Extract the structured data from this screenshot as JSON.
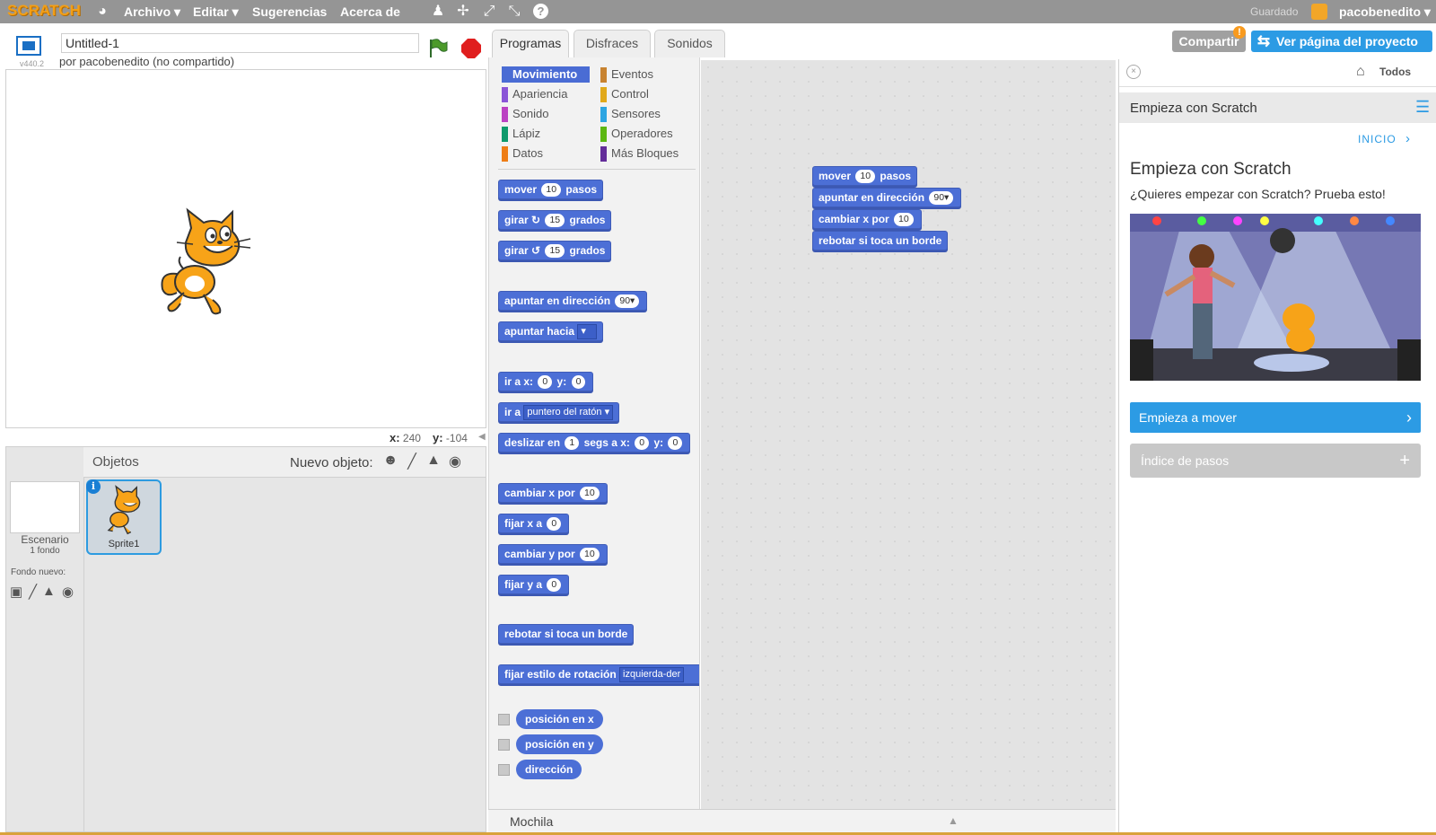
{
  "menubar": {
    "logo": "SCRATCH",
    "items": [
      "Archivo",
      "Editar",
      "Sugerencias",
      "Acerca de"
    ],
    "saved_status": "Guardado",
    "username": "pacobenedito"
  },
  "stage": {
    "project_title": "Untitled-1",
    "byline": "por pacobenedito (no compartido)",
    "version": "v440.2",
    "coords": {
      "x_label": "x:",
      "x_value": "240",
      "y_label": "y:",
      "y_value": "-104"
    }
  },
  "sprites": {
    "header": "Objetos",
    "new_sprite_label": "Nuevo objeto:",
    "stage_label": "Escenario",
    "stage_backdrops": "1 fondo",
    "new_backdrop_label": "Fondo nuevo:",
    "sprite_name": "Sprite1"
  },
  "tabs": [
    "Programas",
    "Disfraces",
    "Sonidos"
  ],
  "categories": [
    {
      "label": "Movimiento",
      "color": "#4a6cd4"
    },
    {
      "label": "Apariencia",
      "color": "#8a55d7"
    },
    {
      "label": "Sonido",
      "color": "#bb42c3"
    },
    {
      "label": "Lápiz",
      "color": "#0e9a6c"
    },
    {
      "label": "Datos",
      "color": "#ee7d16"
    },
    {
      "label": "Eventos",
      "color": "#c88330"
    },
    {
      "label": "Control",
      "color": "#e1a91a"
    },
    {
      "label": "Sensores",
      "color": "#2ca5e2"
    },
    {
      "label": "Operadores",
      "color": "#5cb712"
    },
    {
      "label": "Más Bloques",
      "color": "#632d99"
    }
  ],
  "palette_blocks": {
    "mover": {
      "pre": "mover",
      "val": "10",
      "post": "pasos"
    },
    "girar_der": {
      "pre": "girar",
      "val": "15",
      "post": "grados"
    },
    "girar_izq": {
      "pre": "girar",
      "val": "15",
      "post": "grados"
    },
    "apuntar_dir": {
      "pre": "apuntar en dirección",
      "val": "90▾"
    },
    "apuntar_hacia": {
      "pre": "apuntar hacia",
      "val": "▾"
    },
    "ir_xy": {
      "pre": "ir a x:",
      "x": "0",
      "mid": "y:",
      "y": "0"
    },
    "ir_a": {
      "pre": "ir a",
      "val": "puntero del ratón ▾"
    },
    "deslizar": {
      "pre": "deslizar en",
      "t": "1",
      "mid1": "segs a x:",
      "x": "0",
      "mid2": "y:",
      "y": "0"
    },
    "cambiar_x": {
      "pre": "cambiar x por",
      "val": "10"
    },
    "fijar_x": {
      "pre": "fijar x a",
      "val": "0"
    },
    "cambiar_y": {
      "pre": "cambiar y por",
      "val": "10"
    },
    "fijar_y": {
      "pre": "fijar y a",
      "val": "0"
    },
    "rebotar": {
      "pre": "rebotar si toca un borde"
    },
    "estilo": {
      "pre": "fijar estilo de rotación",
      "val": "izquierda-der"
    },
    "pos_x": "posición en x",
    "pos_y": "posición en y",
    "direccion": "dirección"
  },
  "script_blocks": {
    "mover": {
      "pre": "mover",
      "val": "10",
      "post": "pasos"
    },
    "apuntar": {
      "pre": "apuntar en dirección",
      "val": "90▾"
    },
    "cambiar_x": {
      "pre": "cambiar x por",
      "val": "10"
    },
    "rebotar": "rebotar si toca un borde"
  },
  "backpack": {
    "label": "Mochila"
  },
  "actions": {
    "share": "Compartir",
    "share_badge": "!",
    "see_project": "Ver página del proyecto"
  },
  "tips": {
    "all": "Todos",
    "header_title": "Empieza con Scratch",
    "inicio": "INICIO",
    "title": "Empieza con Scratch",
    "subtitle": "¿Quieres empezar con Scratch? Prueba esto!",
    "start_button": "Empieza a mover",
    "index_button": "Índice de pasos"
  }
}
